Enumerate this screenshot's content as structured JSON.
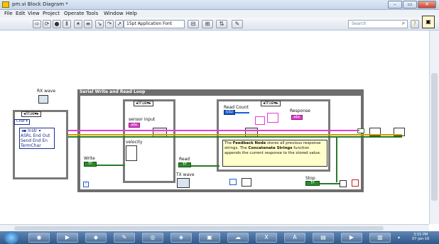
{
  "window": {
    "title": "pm.vi Block Diagram *"
  },
  "menus": [
    "File",
    "Edit",
    "View",
    "Project",
    "Operate",
    "Tools",
    "Window",
    "Help"
  ],
  "toolbar": {
    "font_selector": "15pt Application Font",
    "search_placeholder": "Search"
  },
  "diagram": {
    "rx_wave_label": "RX wave",
    "loop_title": "Serial Write and Read Loop",
    "left_case_true": "True",
    "case1_true": "True",
    "case2_true": "True",
    "char_label": "Char",
    "instr_label": "Instr",
    "prop_items": [
      "ASRL End Out",
      "Send End En",
      "TermChar"
    ],
    "sensor_input": "sensor input",
    "velocity": "velocity",
    "write": "Write",
    "read": "Read",
    "tx_wave": "TX wave",
    "read_count": "Read Count",
    "response": "Response",
    "stop": "Stop",
    "note_parts": {
      "p1": "The ",
      "b1": "Feedback Node",
      "p2": " stores all previous response strings. The ",
      "b2": "Concatenate Strings",
      "p3": " function appends the current response to the stored value."
    }
  },
  "taskbar": {
    "time": "3:55 PM",
    "date": "07-Jan-16"
  },
  "colors": {
    "string_wire": "#e040d0",
    "bool_wire": "#2a7a2a",
    "num_wire": "#1a5fcf",
    "ref_wire": "#2a7a2a"
  }
}
